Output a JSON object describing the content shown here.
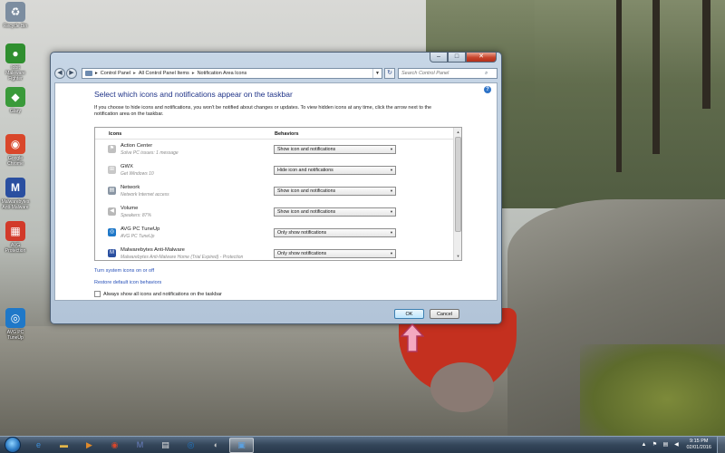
{
  "desktop": {
    "icons": [
      {
        "label": "Recycle Bin",
        "icon": "recycle-bin-icon",
        "glyph": "♻",
        "color": "#7c8da0"
      },
      {
        "label": "Iobit Maleware Fighter",
        "icon": "malware-fighter-icon",
        "glyph": "●",
        "color": "#2f8f2f"
      },
      {
        "label": "Glary",
        "icon": "glary-icon",
        "glyph": "◆",
        "color": "#3a9a3a"
      },
      {
        "label": "Google Chrome",
        "icon": "chrome-icon",
        "glyph": "◉",
        "color": "#d9472b"
      },
      {
        "label": "Malwarebytes Anti-Malware",
        "icon": "malwarebytes-icon",
        "glyph": "M",
        "color": "#2a4fa0"
      },
      {
        "label": "AVG Protection",
        "icon": "avg-icon",
        "glyph": "▦",
        "color": "#d23a2a"
      },
      {
        "label": "AVG PC TuneUp",
        "icon": "avg-tuneup-icon",
        "glyph": "◎",
        "color": "#1f78c8"
      }
    ]
  },
  "window": {
    "caption": {
      "minimize": "–",
      "maximize": "□",
      "close": "✕"
    },
    "address": {
      "crumbs": [
        "Control Panel",
        "All Control Panel Items",
        "Notification Area Icons"
      ],
      "separator": "▸"
    },
    "search": {
      "placeholder": "Search Control Panel"
    },
    "heading": "Select which icons and notifications appear on the taskbar",
    "description": "If you choose to hide icons and notifications, you won't be notified about changes or updates. To view hidden icons at any time, click the arrow next to the notification area on the taskbar.",
    "columns": {
      "icons": "Icons",
      "behaviors": "Behaviors"
    },
    "rows": [
      {
        "name": "Action Center",
        "sub": "Solve PC issues: 1 message",
        "behavior": "Show icon and notifications",
        "icon": "flag-icon",
        "glyph": "⚑",
        "color": "#c0c0c0"
      },
      {
        "name": "GWX",
        "sub": "Get Windows 10",
        "behavior": "Hide icon and notifications",
        "icon": "windows-icon",
        "glyph": "⊞",
        "color": "#c8c8c8"
      },
      {
        "name": "Network",
        "sub": "Network Internet access",
        "behavior": "Show icon and notifications",
        "icon": "network-icon",
        "glyph": "▤",
        "color": "#8a96a4"
      },
      {
        "name": "Volume",
        "sub": "Speakers: 87%",
        "behavior": "Show icon and notifications",
        "icon": "speaker-icon",
        "glyph": "◀",
        "color": "#b8b8b8"
      },
      {
        "name": "AVG PC TuneUp",
        "sub": "AVG PC TuneUp",
        "behavior": "Only show notifications",
        "icon": "avg-tuneup-icon",
        "glyph": "◎",
        "color": "#1f78c8"
      },
      {
        "name": "Malwarebytes Anti-Malware",
        "sub": "Malwarebytes Anti-Malware Home (Trial Expired) - Protection",
        "behavior": "Only show notifications",
        "icon": "malwarebytes-icon",
        "glyph": "M",
        "color": "#2a4fa0"
      }
    ],
    "links": {
      "system_icons": "Turn system icons on or off",
      "restore": "Restore default icon behaviors"
    },
    "always_show_label": "Always show all icons and notifications on the taskbar",
    "buttons": {
      "ok": "OK",
      "cancel": "Cancel"
    }
  },
  "taskbar": {
    "items": [
      {
        "icon": "internet-explorer-icon",
        "glyph": "e",
        "color": "#3d8fd9"
      },
      {
        "icon": "folder-icon",
        "glyph": "▬",
        "color": "#e3b64a"
      },
      {
        "icon": "media-player-icon",
        "glyph": "▶",
        "color": "#e08a2a"
      },
      {
        "icon": "chrome-icon",
        "glyph": "◉",
        "color": "#d9472b"
      },
      {
        "icon": "malwarebytes-icon",
        "glyph": "M",
        "color": "#6a7fc0"
      },
      {
        "icon": "notepad-icon",
        "glyph": "▤",
        "color": "#e6e6e6"
      },
      {
        "icon": "avg-tuneup-icon",
        "glyph": "◎",
        "color": "#1f78c8"
      },
      {
        "icon": "paint-icon",
        "glyph": "◐",
        "color": "#c8c8c8"
      },
      {
        "icon": "control-panel-icon",
        "glyph": "▣",
        "color": "#5aa0e0",
        "active": true
      }
    ],
    "tray_icons": [
      "chevron-up-icon",
      "flag-icon",
      "network-icon",
      "speaker-icon"
    ],
    "clock": {
      "time": "9:15 PM",
      "date": "02/01/2016"
    }
  }
}
